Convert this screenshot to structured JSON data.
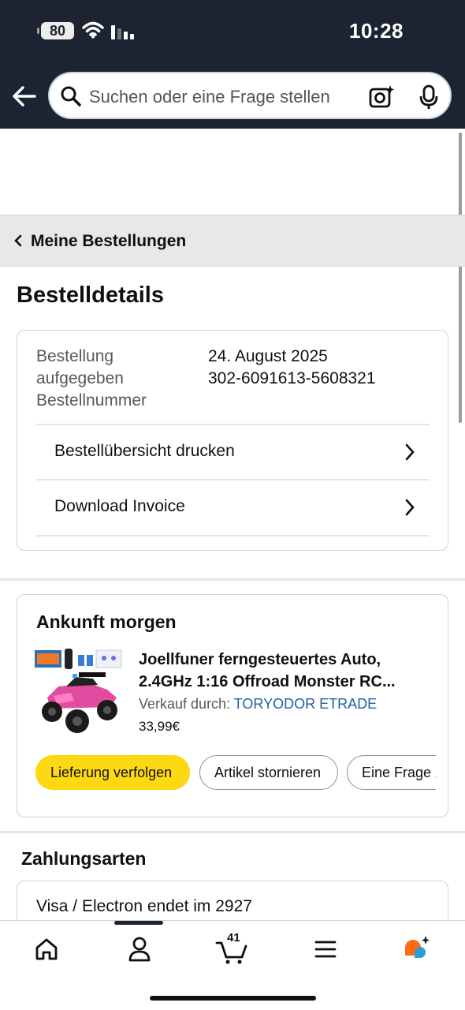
{
  "status_bar": {
    "battery": "80",
    "time": "10:28"
  },
  "header": {
    "back_icon": "back-arrow-icon",
    "search_placeholder": "Suchen oder eine Frage stellen",
    "search_icon": "search-icon",
    "camera_icon": "camera-sparkle-icon",
    "mic_icon": "microphone-icon",
    "background_color": "#1c2331"
  },
  "breadcrumb": {
    "label": "Meine Bestellungen"
  },
  "page_title": "Bestelldetails",
  "order_info": {
    "labels": [
      "Bestellung",
      "aufgegeben",
      "Bestellnummer"
    ],
    "date": "24. August 2025",
    "order_number": "302-6091613-5608321",
    "actions": [
      {
        "label": "Bestellübersicht drucken"
      },
      {
        "label": "Download Invoice"
      }
    ]
  },
  "shipment": {
    "arrival": "Ankunft morgen",
    "product": {
      "title_line1": "Joellfuner ferngesteuertes Auto,",
      "title_line2": "2.4GHz 1:16 Offroad Monster RC...",
      "seller_prefix": "Verkauf durch:",
      "seller_name": "TORYODOR ETRADE",
      "price": "33,99€"
    },
    "buttons": [
      {
        "label": "Lieferung verfolgen"
      },
      {
        "label": "Artikel stornieren"
      },
      {
        "label": "Eine Frage z"
      }
    ],
    "accent_color": "#ffd814",
    "link_color": "#2162a1"
  },
  "payment": {
    "title": "Zahlungsarten",
    "card_name": "Visa / Electron",
    "card_ending": "endet im 2927"
  },
  "bottom_nav": {
    "items": [
      {
        "icon": "home-icon"
      },
      {
        "icon": "user-icon"
      },
      {
        "icon": "cart-icon",
        "count": "41"
      },
      {
        "icon": "menu-icon"
      },
      {
        "icon": "ai-assistant-icon"
      }
    ]
  }
}
